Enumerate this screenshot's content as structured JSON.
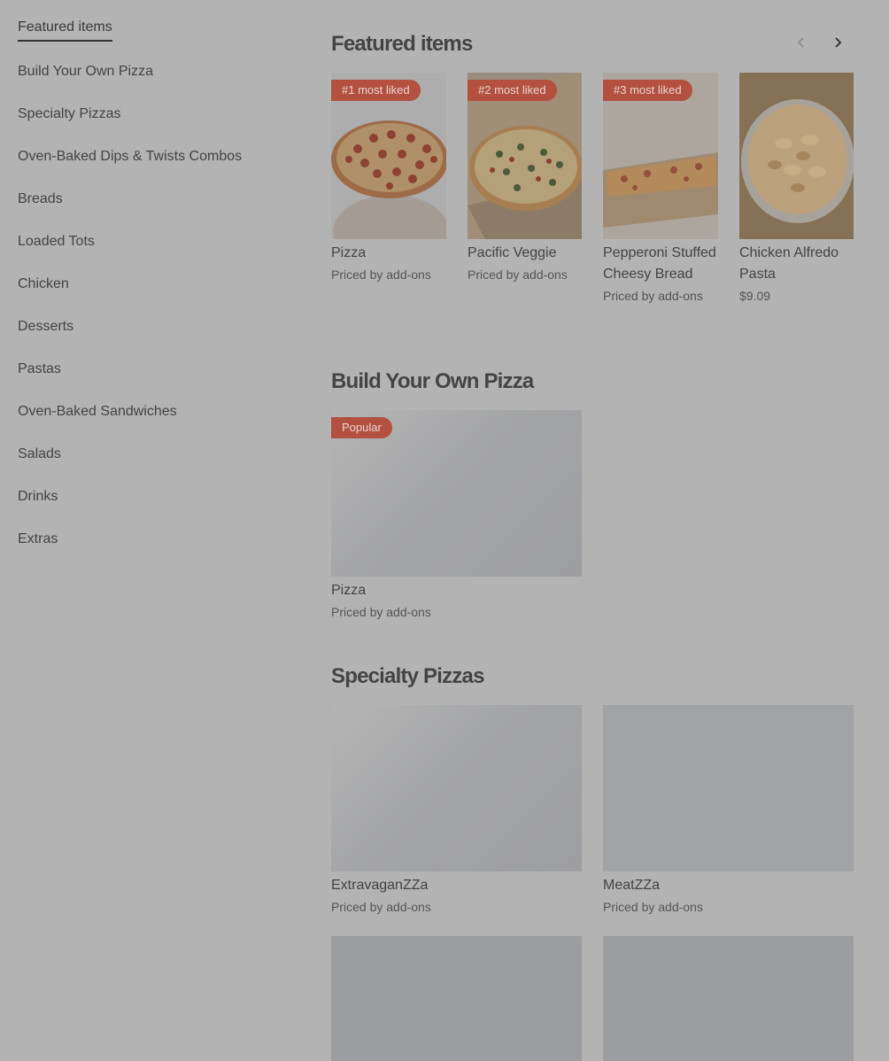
{
  "sidebar": {
    "items": [
      {
        "label": "Featured items"
      },
      {
        "label": "Build Your Own Pizza"
      },
      {
        "label": "Specialty Pizzas"
      },
      {
        "label": "Oven-Baked Dips & Twists Combos"
      },
      {
        "label": "Breads"
      },
      {
        "label": "Loaded Tots"
      },
      {
        "label": "Chicken"
      },
      {
        "label": "Desserts"
      },
      {
        "label": "Pastas"
      },
      {
        "label": "Oven-Baked Sandwiches"
      },
      {
        "label": "Salads"
      },
      {
        "label": "Drinks"
      },
      {
        "label": "Extras"
      }
    ]
  },
  "featured": {
    "title": "Featured items",
    "prev_icon": "chevron-left-icon",
    "next_icon": "chevron-right-icon",
    "items": [
      {
        "badge": "#1 most liked",
        "name": "Pizza",
        "price": "Priced by add-ons"
      },
      {
        "badge": "#2 most liked",
        "name": "Pacific Veggie",
        "price": "Priced by add-ons"
      },
      {
        "badge": "#3 most liked",
        "name": "Pepperoni Stuffed Cheesy Bread",
        "price": "Priced by add-ons"
      },
      {
        "badge": "",
        "name": "Chicken Alfredo Pasta",
        "price": "$9.09"
      }
    ]
  },
  "build_your_own": {
    "title": "Build Your Own Pizza",
    "items": [
      {
        "badge": "Popular",
        "name": "Pizza",
        "price": "Priced by add-ons"
      }
    ]
  },
  "specialty": {
    "title": "Specialty Pizzas",
    "items": [
      {
        "name": "ExtravaganZZa",
        "price": "Priced by add-ons"
      },
      {
        "name": "MeatZZa",
        "price": "Priced by add-ons"
      }
    ]
  },
  "colors": {
    "overlay_bg": "#b3b3b3",
    "badge_bg": "#b3503f",
    "placeholder": "#9fa0a3"
  }
}
